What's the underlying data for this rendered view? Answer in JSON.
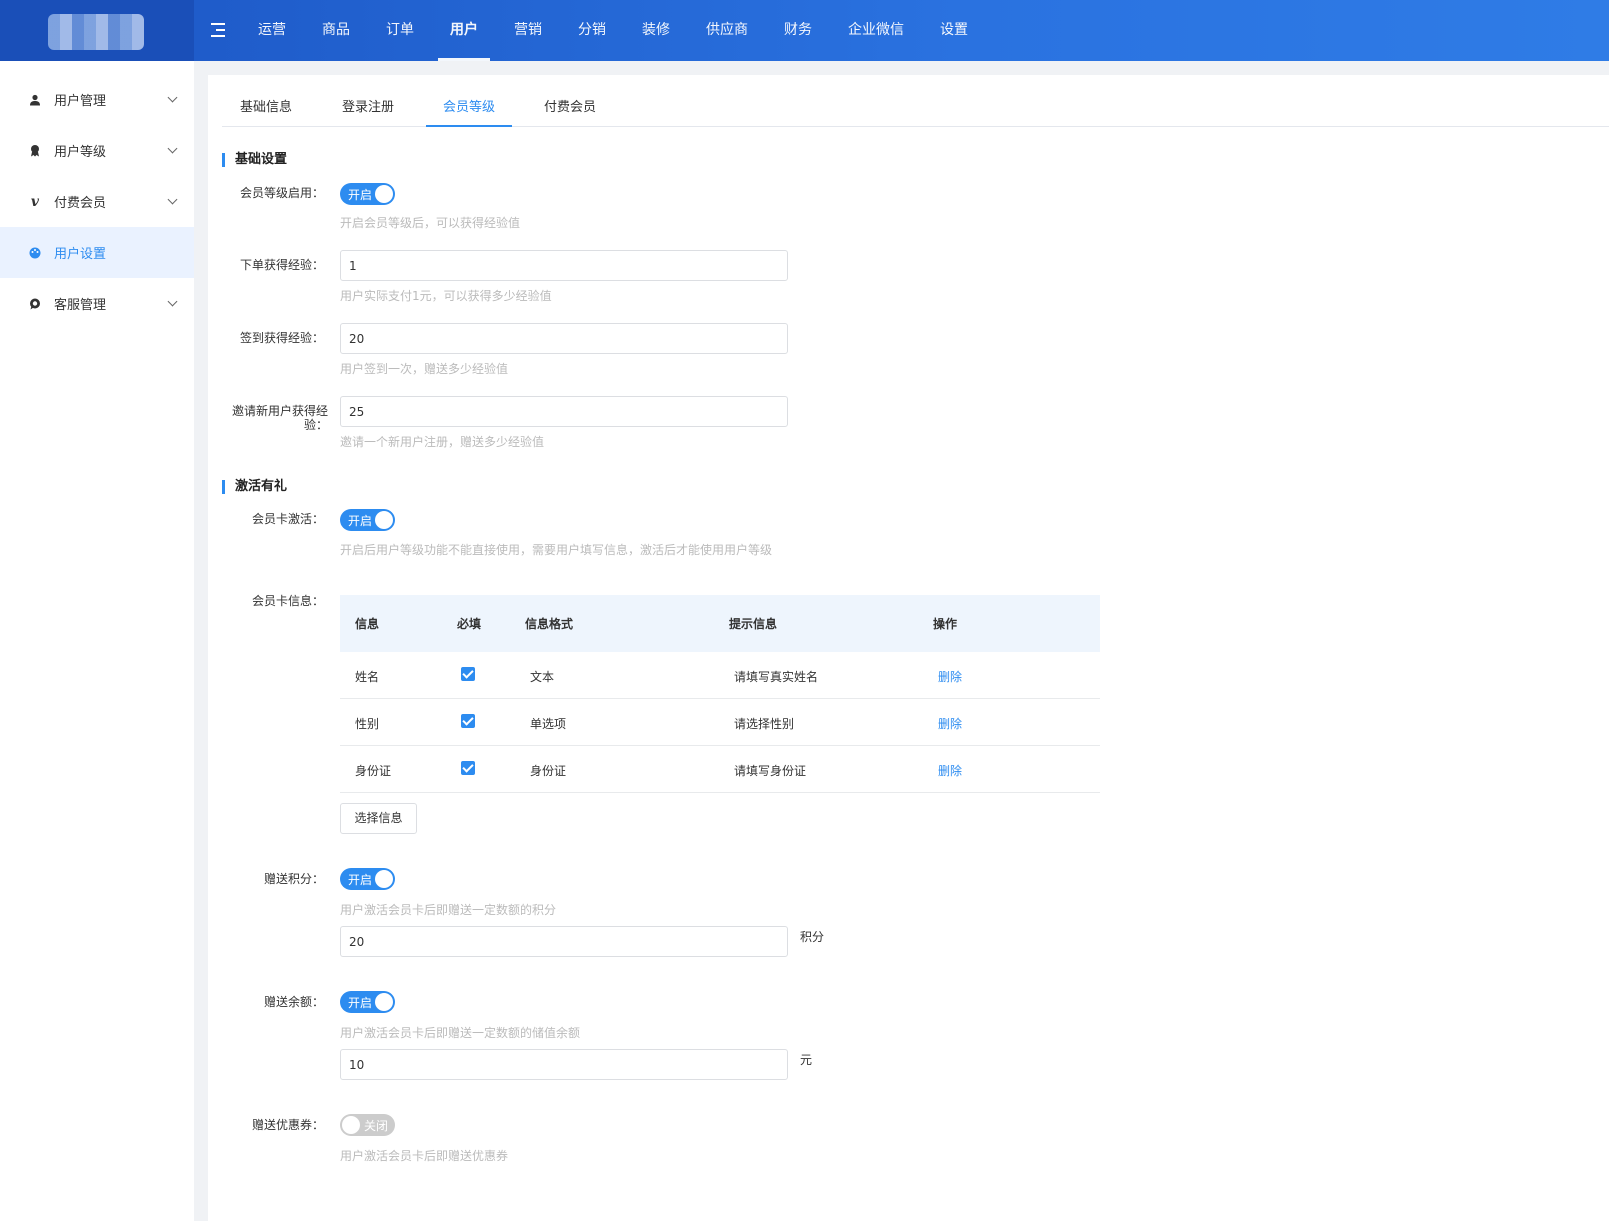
{
  "topnav": {
    "items": [
      "运营",
      "商品",
      "订单",
      "用户",
      "营销",
      "分销",
      "装修",
      "供应商",
      "财务",
      "企业微信",
      "设置"
    ],
    "active_index": 3
  },
  "sidebar": {
    "items": [
      {
        "label": "用户管理",
        "icon": "user-icon"
      },
      {
        "label": "用户等级",
        "icon": "medal-icon"
      },
      {
        "label": "付费会员",
        "icon": "vimeo-icon"
      },
      {
        "label": "用户设置",
        "icon": "palette-icon",
        "active": true
      },
      {
        "label": "客服管理",
        "icon": "chat-icon"
      }
    ]
  },
  "tabs": [
    "基础信息",
    "登录注册",
    "会员等级",
    "付费会员"
  ],
  "section_basic": {
    "title": "基础设置",
    "level_enable": {
      "label": "会员等级启用：",
      "switch": "开启",
      "hint": "开启会员等级后，可以获得经验值"
    },
    "order_exp": {
      "label": "下单获得经验：",
      "value": "1",
      "hint": "用户实际支付1元，可以获得多少经验值"
    },
    "sign_exp": {
      "label": "签到获得经验：",
      "value": "20",
      "hint": "用户签到一次，赠送多少经验值"
    },
    "invite_exp": {
      "label_line1": "邀请新用户获得经",
      "label_line2": "验：",
      "value": "25",
      "hint": "邀请一个新用户注册，赠送多少经验值"
    }
  },
  "section_activate": {
    "title": "激活有礼",
    "card_activate": {
      "label": "会员卡激活：",
      "switch": "开启",
      "hint": "开启后用户等级功能不能直接使用，需要用户填写信息，激活后才能使用用户等级"
    },
    "card_info": {
      "label": "会员卡信息：",
      "headers": [
        "信息",
        "必填",
        "信息格式",
        "提示信息",
        "操作"
      ],
      "rows": [
        {
          "info": "姓名",
          "format": "文本",
          "tip": "请填写真实姓名",
          "action": "删除"
        },
        {
          "info": "性别",
          "format": "单选项",
          "tip": "请选择性别",
          "action": "删除"
        },
        {
          "info": "身份证",
          "format": "身份证",
          "tip": "请填写身份证",
          "action": "删除"
        }
      ],
      "select_button": "选择信息"
    },
    "gift_points": {
      "label": "赠送积分：",
      "switch": "开启",
      "hint": "用户激活会员卡后即赠送一定数额的积分",
      "value": "20",
      "unit": "积分"
    },
    "gift_balance": {
      "label": "赠送余额：",
      "switch": "开启",
      "hint": "用户激活会员卡后即赠送一定数额的储值余额",
      "value": "10",
      "unit": "元"
    },
    "gift_coupon": {
      "label": "赠送优惠券：",
      "switch": "关闭",
      "hint": "用户激活会员卡后即赠送优惠券"
    }
  },
  "colors": {
    "primary": "#2d8cf0",
    "topbar": "#2a72e0",
    "hint": "#bbbbbb"
  }
}
